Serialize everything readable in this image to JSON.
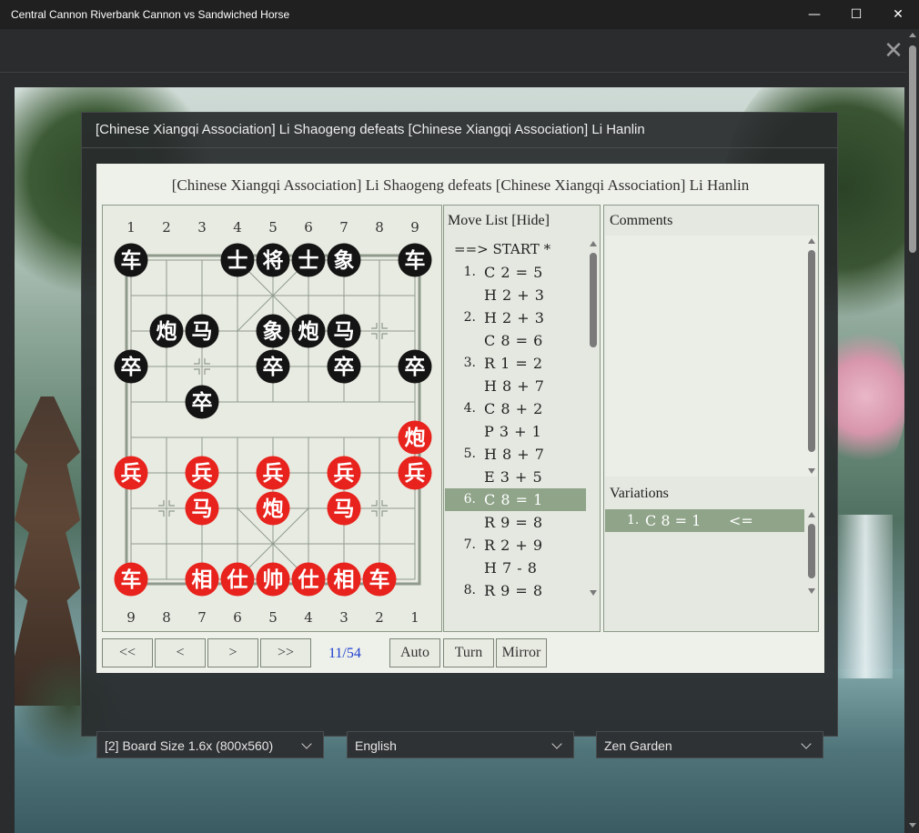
{
  "window": {
    "title": "Central Cannon Riverbank Cannon vs Sandwiched Horse",
    "minimize": "—",
    "maximize": "☐",
    "close": "✕"
  },
  "page": {
    "close_glyph": "✕"
  },
  "dialog": {
    "title": "[Chinese Xiangqi Association] Li Shaogeng defeats [Chinese Xiangqi Association] Li Hanlin"
  },
  "game": {
    "title": "[Chinese Xiangqi Association] Li Shaogeng defeats [Chinese Xiangqi Association] Li Hanlin",
    "top_files": [
      "1",
      "2",
      "3",
      "4",
      "5",
      "6",
      "7",
      "8",
      "9"
    ],
    "bottom_files": [
      "9",
      "8",
      "7",
      "6",
      "5",
      "4",
      "3",
      "2",
      "1"
    ],
    "pieces": [
      {
        "char": "车",
        "side": "black",
        "file": 0,
        "rank": 0
      },
      {
        "char": "士",
        "side": "black",
        "file": 3,
        "rank": 0
      },
      {
        "char": "将",
        "side": "black",
        "file": 4,
        "rank": 0
      },
      {
        "char": "士",
        "side": "black",
        "file": 5,
        "rank": 0
      },
      {
        "char": "象",
        "side": "black",
        "file": 6,
        "rank": 0
      },
      {
        "char": "车",
        "side": "black",
        "file": 8,
        "rank": 0
      },
      {
        "char": "炮",
        "side": "black",
        "file": 1,
        "rank": 2
      },
      {
        "char": "马",
        "side": "black",
        "file": 2,
        "rank": 2
      },
      {
        "char": "象",
        "side": "black",
        "file": 4,
        "rank": 2
      },
      {
        "char": "炮",
        "side": "black",
        "file": 5,
        "rank": 2
      },
      {
        "char": "马",
        "side": "black",
        "file": 6,
        "rank": 2
      },
      {
        "char": "卒",
        "side": "black",
        "file": 0,
        "rank": 3
      },
      {
        "char": "卒",
        "side": "black",
        "file": 4,
        "rank": 3
      },
      {
        "char": "卒",
        "side": "black",
        "file": 6,
        "rank": 3
      },
      {
        "char": "卒",
        "side": "black",
        "file": 8,
        "rank": 3
      },
      {
        "char": "卒",
        "side": "black",
        "file": 2,
        "rank": 4
      },
      {
        "char": "炮",
        "side": "red",
        "file": 8,
        "rank": 5
      },
      {
        "char": "兵",
        "side": "red",
        "file": 0,
        "rank": 6
      },
      {
        "char": "兵",
        "side": "red",
        "file": 2,
        "rank": 6
      },
      {
        "char": "兵",
        "side": "red",
        "file": 4,
        "rank": 6
      },
      {
        "char": "兵",
        "side": "red",
        "file": 6,
        "rank": 6
      },
      {
        "char": "兵",
        "side": "red",
        "file": 8,
        "rank": 6
      },
      {
        "char": "马",
        "side": "red",
        "file": 2,
        "rank": 7
      },
      {
        "char": "炮",
        "side": "red",
        "file": 4,
        "rank": 7
      },
      {
        "char": "马",
        "side": "red",
        "file": 6,
        "rank": 7
      },
      {
        "char": "车",
        "side": "red",
        "file": 0,
        "rank": 9
      },
      {
        "char": "相",
        "side": "red",
        "file": 2,
        "rank": 9
      },
      {
        "char": "仕",
        "side": "red",
        "file": 3,
        "rank": 9
      },
      {
        "char": "帅",
        "side": "red",
        "file": 4,
        "rank": 9
      },
      {
        "char": "仕",
        "side": "red",
        "file": 5,
        "rank": 9
      },
      {
        "char": "相",
        "side": "red",
        "file": 6,
        "rank": 9
      },
      {
        "char": "车",
        "side": "red",
        "file": 7,
        "rank": 9
      }
    ],
    "colors": {
      "red": "#e8221c",
      "black": "#141414",
      "line": "#8f9a8c",
      "highlight": "#8fa489"
    }
  },
  "moves": {
    "header": "Move List [Hide]",
    "start": "==> START *",
    "rows": [
      {
        "num": "1.",
        "move": "C 2 = 5"
      },
      {
        "num": "",
        "move": "H 2 + 3"
      },
      {
        "num": "2.",
        "move": "H 2 + 3"
      },
      {
        "num": "",
        "move": "C 8 = 6"
      },
      {
        "num": "3.",
        "move": "R 1 = 2"
      },
      {
        "num": "",
        "move": "H 8 + 7"
      },
      {
        "num": "4.",
        "move": "C 8 + 2"
      },
      {
        "num": "",
        "move": "P 3 + 1"
      },
      {
        "num": "5.",
        "move": "H 8 + 7"
      },
      {
        "num": "",
        "move": "E 3 + 5"
      },
      {
        "num": "6.",
        "move": "C 8 = 1",
        "selected": true
      },
      {
        "num": "",
        "move": "R 9 = 8"
      },
      {
        "num": "7.",
        "move": "R 2 + 9"
      },
      {
        "num": "",
        "move": "H 7 - 8"
      },
      {
        "num": "8.",
        "move": "R 9 = 8"
      }
    ]
  },
  "comments": {
    "header": "Comments"
  },
  "variations": {
    "header": "Variations",
    "row": {
      "num": "1.",
      "move": "C 8 = 1",
      "arrow": "<="
    }
  },
  "controls": {
    "first": "<<",
    "prev": "<",
    "next": ">",
    "last": ">>",
    "counter": "11/54",
    "auto": "Auto",
    "turn": "Turn",
    "mirror": "Mirror"
  },
  "settings": {
    "board_size": "[2] Board Size 1.6x (800x560)",
    "language": "English",
    "theme": "Zen Garden"
  }
}
